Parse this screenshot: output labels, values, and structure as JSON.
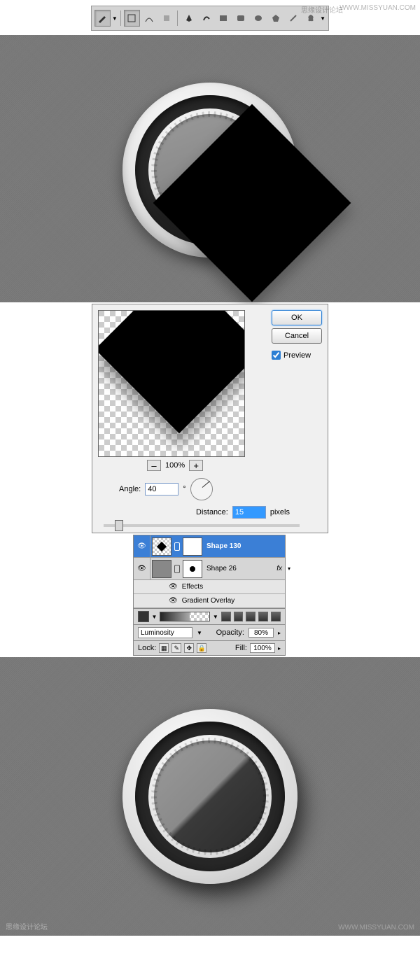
{
  "watermarks": {
    "cn": "思缘设计论坛",
    "url": "WWW.MISSYUAN.COM"
  },
  "dialog": {
    "ok": "OK",
    "cancel": "Cancel",
    "preview": "Preview",
    "preview_checked": true,
    "zoom": "100%",
    "angle_label": "Angle:",
    "angle_value": "40",
    "angle_unit": "°",
    "distance_label": "Distance:",
    "distance_value": "15",
    "distance_unit": "pixels"
  },
  "layers": {
    "rows": [
      {
        "name": "Shape 130",
        "selected": true
      },
      {
        "name": "Shape 26",
        "selected": false,
        "fx": "fx"
      }
    ],
    "effects": "Effects",
    "grad_overlay": "Gradient Overlay"
  },
  "panel": {
    "blend": "Luminosity",
    "opacity_label": "Opacity:",
    "opacity_value": "80%",
    "lock_label": "Lock:",
    "fill_label": "Fill:",
    "fill_value": "100%"
  }
}
